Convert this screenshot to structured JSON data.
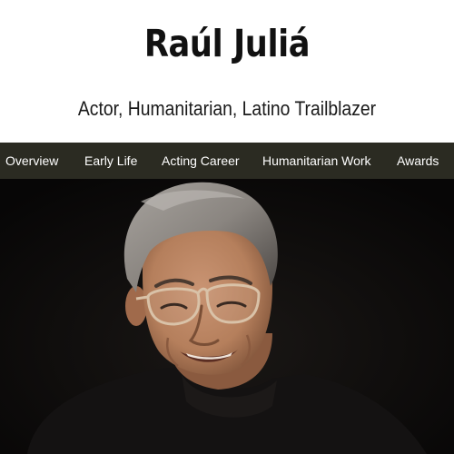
{
  "header": {
    "title": "Raúl Juliá",
    "subtitle": "Actor, Humanitarian, Latino Trailblazer"
  },
  "nav": {
    "items": [
      {
        "label": "Overview"
      },
      {
        "label": "Early Life"
      },
      {
        "label": "Acting Career"
      },
      {
        "label": "Humanitarian Work"
      },
      {
        "label": "Awards"
      }
    ]
  },
  "hero": {
    "image": "portrait-photo",
    "colors": {
      "background": "#0c0b0a",
      "skin": "#b57f5c",
      "hair": "#8a8580",
      "sweater": "#141212"
    }
  },
  "colors": {
    "navbar_bg": "#2b2b22",
    "nav_text": "#ffffff",
    "title_text": "#111111"
  }
}
